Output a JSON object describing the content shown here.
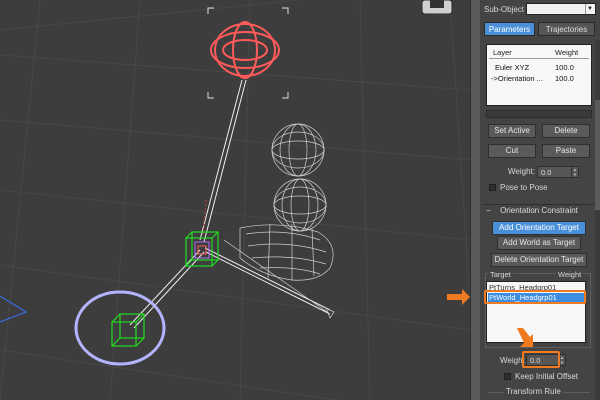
{
  "command_panel": {
    "sub_object_label": "Sub-Object",
    "tabs": [
      {
        "label": "Parameters",
        "active": true
      },
      {
        "label": "Trajectories",
        "active": false
      }
    ],
    "layers": {
      "headers": [
        "Layer",
        "Weight"
      ],
      "rows": [
        {
          "name": "Euler XYZ",
          "weight": "100.0"
        },
        {
          "name": "->Orientation ...",
          "weight": "100.0"
        }
      ]
    },
    "layer_buttons": {
      "set_active": "Set Active",
      "delete": "Delete",
      "cut": "Cut",
      "paste": "Paste"
    },
    "layer_weight": {
      "label": "Weight:",
      "value": "0.0"
    },
    "pose_to_pose": "Pose to Pose",
    "orientation_constraint": {
      "rollout_title": "Orientation Constraint",
      "add_target": "Add Orientation Target",
      "add_world": "Add World as Target",
      "delete_target": "Delete Orientation Target",
      "target_header": "Target",
      "weight_header": "Weight",
      "targets": [
        {
          "name": "PtTurns_Headgrp01",
          "selected": false
        },
        {
          "name": "PtWorld_Headgrp01",
          "selected": true
        }
      ],
      "weight": {
        "label": "Weight",
        "value": "0.0"
      },
      "keep_initial_offset": "Keep Initial Offset",
      "transform_rule": "Transform Rule"
    }
  },
  "colors": {
    "accent_blue": "#4a90d9",
    "selection_blue": "#3c8de0",
    "highlight_orange": "#f07a20",
    "rotate_gizmo_red": "#ff5a5a",
    "helper_green": "#22dd22",
    "circle_lavender": "#b3b3ff",
    "wireframe_grey": "#cfcfcf"
  }
}
